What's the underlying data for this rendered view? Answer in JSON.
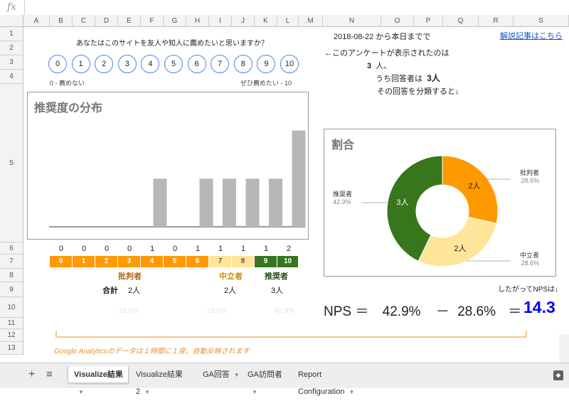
{
  "formula_bar": {
    "fx_label": "fx"
  },
  "columns": [
    "A",
    "B",
    "C",
    "D",
    "E",
    "F",
    "G",
    "H",
    "I",
    "J",
    "K",
    "L",
    "M",
    "N",
    "O",
    "P",
    "Q",
    "R",
    "S"
  ],
  "rows": [
    "1",
    "2",
    "3",
    "4",
    "5",
    "6",
    "7",
    "8",
    "9",
    "10",
    "11",
    "12",
    "13"
  ],
  "survey": {
    "question": "あなたはこのサイトを友人や知人に薦めたいと思いますか？",
    "scale": [
      "0",
      "1",
      "2",
      "3",
      "4",
      "5",
      "6",
      "7",
      "8",
      "9",
      "10"
    ],
    "low_label": "0 - 薦めない",
    "high_label": "ぜひ薦めたい - 10"
  },
  "info": {
    "date": "2018-08-22",
    "date_suffix": "から本日までで",
    "shown_label": "←このアンケートが表示されたのは",
    "shown_count": "3",
    "shown_unit": "人、",
    "respondents_label": "うち回答者は",
    "respondents_count": "3人",
    "classify_label": "その回答を分類すると↓",
    "article_link": "解説記事はこちら"
  },
  "chart_data": [
    {
      "type": "bar",
      "title": "推奨度の分布",
      "categories": [
        "0",
        "1",
        "2",
        "3",
        "4",
        "5",
        "6",
        "7",
        "8",
        "9",
        "10"
      ],
      "values": [
        0,
        0,
        0,
        0,
        1,
        0,
        1,
        1,
        1,
        1,
        2
      ],
      "color": "#b7b7b7",
      "ylim": [
        0,
        2.2
      ]
    },
    {
      "type": "pie",
      "title": "割合",
      "slices": [
        {
          "name": "批判者",
          "label": "2人",
          "percent": "28.6%",
          "value": 28.6,
          "color": "#ff9900"
        },
        {
          "name": "中立者",
          "label": "2人",
          "percent": "28.6%",
          "value": 28.6,
          "color": "#ffe599"
        },
        {
          "name": "推奨者",
          "label": "3人",
          "percent": "42.9%",
          "value": 42.9,
          "color": "#38761d"
        }
      ]
    }
  ],
  "scores_row": {
    "counts": [
      "0",
      "0",
      "0",
      "0",
      "1",
      "0",
      "1",
      "1",
      "1",
      "1",
      "2"
    ],
    "cells": [
      "0",
      "1",
      "2",
      "3",
      "4",
      "5",
      "6",
      "7",
      "8",
      "9",
      "10"
    ],
    "cell_colors": [
      "#ff9900",
      "#ff9900",
      "#ff9900",
      "#ff9900",
      "#ff9900",
      "#ff9900",
      "#ff9900",
      "#ffe599",
      "#ffe599",
      "#38761d",
      "#38761d"
    ],
    "cell_text_colors": [
      "#fff",
      "#fff",
      "#fff",
      "#fff",
      "#fff",
      "#fff",
      "#fff",
      "#6b5a1e",
      "#6b5a1e",
      "#fff",
      "#fff"
    ]
  },
  "groups": {
    "detractors": "批判者",
    "passives": "中立者",
    "promoters": "推奨者",
    "total_label": "合計",
    "detractors_total": "2人",
    "passives_total": "2人",
    "promoters_total": "3人",
    "detractors_pct": "28.6%",
    "passives_pct": "28.6%",
    "promoters_pct": "42.9%"
  },
  "nps": {
    "therefore": "したがってNPSは↓",
    "label": "NPS",
    "eq1": "＝",
    "promoters_pct": "42.9%",
    "minus": "－",
    "detractors_pct": "28.6%",
    "eq2": "＝",
    "score": "14.3",
    "score_color": "#0000ff"
  },
  "footer_note": "Google Analyticsのデータは１時間に１度、自動反映されます",
  "sheet_tabs": [
    {
      "label": "Visualize結果",
      "active": true
    },
    {
      "label": "Visualize結果2",
      "active": false
    },
    {
      "label": "GA回答",
      "active": false
    },
    {
      "label": "GA訪問者",
      "active": false
    },
    {
      "label": "Report Configuration",
      "active": false
    }
  ],
  "icons": {
    "add_sheet": "+",
    "all_sheets": "≡",
    "explore": "explore-icon"
  }
}
